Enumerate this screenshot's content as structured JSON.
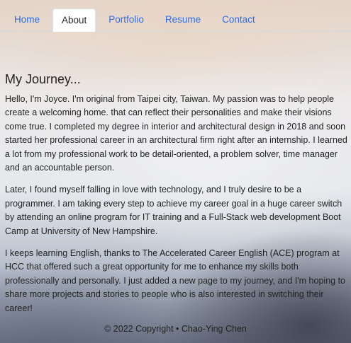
{
  "nav": {
    "items": [
      {
        "label": "Home"
      },
      {
        "label": "About"
      },
      {
        "label": "Portfolio"
      },
      {
        "label": "Resume"
      },
      {
        "label": "Contact"
      }
    ],
    "active": "About"
  },
  "main": {
    "heading": "My Journey...",
    "paragraphs": [
      "Hello, I'm Joyce. I'm original from Taipei city, Taiwan. My passion was to help people create a welcoming home. that can reflect their personalities and make their visions come true. I completed my degree in interior and architectural design in 2018 and soon started her professional career in an architectural firm right after an internship. I learned a lot from my professional work to be detail-oriented, a problem solver, time manager and an accountable person.",
      "Later, I found myself falling in love with technology, and I truly desire to be a programmer. I am taking every step to achieve my career goal in a huge career switch by attending an online program for IT training and a Full-Stack web development Boot Camp at University of New Hampshire.",
      "I keeps learning English, thanks to The Accelerated Career English (ACE) program at HCC that offered such a great opportunity for me to enhance my skills both professionally and personally. I just added a new page to my journey, and I'm hoping to share more projects and stories to people who is also interested in switching their career!"
    ]
  },
  "footer": {
    "text": "© 2022 Copyright • Chao-Ying Chen"
  },
  "colors": {
    "link": "#2f6de0",
    "active_tab_bg": "#ffffff"
  }
}
